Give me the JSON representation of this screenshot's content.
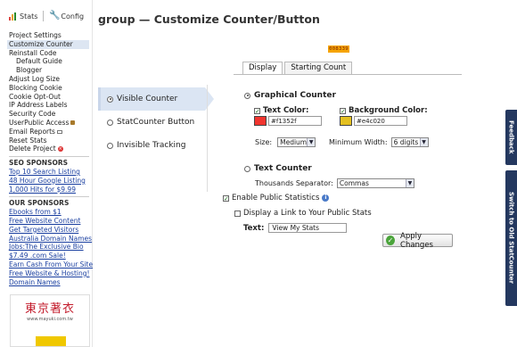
{
  "topnav": {
    "stats_label": "Stats",
    "config_label": "Config"
  },
  "sidebar": {
    "items": [
      {
        "label": "Project Settings",
        "sub": false,
        "active": false
      },
      {
        "label": "Customize Counter",
        "sub": false,
        "active": true
      },
      {
        "label": "Reinstall Code",
        "sub": false,
        "active": false
      },
      {
        "label": "Default Guide",
        "sub": true,
        "active": false
      },
      {
        "label": "Blogger",
        "sub": true,
        "active": false
      },
      {
        "label": "Adjust Log Size",
        "sub": false,
        "active": false
      },
      {
        "label": "Blocking Cookie",
        "sub": false,
        "active": false
      },
      {
        "label": "Cookie Opt-Out",
        "sub": false,
        "active": false
      },
      {
        "label": "IP Address Labels",
        "sub": false,
        "active": false
      },
      {
        "label": "Security Code",
        "sub": false,
        "active": false
      },
      {
        "label": "UserPublic Access",
        "sub": false,
        "active": false,
        "icon": "lock-icon"
      },
      {
        "label": "Email Reports",
        "sub": false,
        "active": false,
        "icon": "mail-icon"
      },
      {
        "label": "Reset Stats",
        "sub": false,
        "active": false
      },
      {
        "label": "Delete Project",
        "sub": false,
        "active": false,
        "icon": "delete-icon"
      }
    ],
    "seo_sponsors_title": "SEO SPONSORS",
    "seo_sponsors": [
      "Top 10 Search Listing",
      "48 Hour Google Listing",
      "1,000 Hits for $9.99"
    ],
    "our_sponsors_title": "OUR SPONSORS",
    "our_sponsors": [
      "Ebooks from $1",
      "Free Website Content",
      "Get Targeted Visitors",
      "Australia Domain Names",
      "Jobs:The Exclusive Bio",
      "$7.49 .com Sale!",
      "Earn Cash From Your Site",
      "Free Website & Hosting!",
      "Domain Names"
    ],
    "ad": {
      "title": "東京著衣",
      "url": "www.mayuki.com.tw"
    }
  },
  "page_title": "group — Customize Counter/Button",
  "counter_badge": "008339",
  "tabs": [
    {
      "label": "Display",
      "active": true
    },
    {
      "label": "Starting Count",
      "active": false
    }
  ],
  "counter_types": [
    {
      "label": "Visible Counter",
      "selected": true
    },
    {
      "label": "StatCounter Button",
      "selected": false
    },
    {
      "label": "Invisible Tracking",
      "selected": false
    }
  ],
  "options": {
    "graphical_label": "Graphical Counter",
    "text_color_label": "Text Color:",
    "text_color_value": "#f1352f",
    "bg_color_label": "Background Color:",
    "bg_color_value": "#e4c020",
    "size_label": "Size:",
    "size_value": "Medium",
    "min_width_label": "Minimum Width:",
    "min_width_value": "6 digits",
    "text_counter_label": "Text Counter",
    "thousands_label": "Thousands Separator:",
    "thousands_value": "Commas",
    "enable_public_label": "Enable Public Statistics",
    "display_link_label": "Display a Link to Your Public Stats",
    "text_label": "Text:",
    "text_value": "View My Stats",
    "apply_label": "Apply Changes"
  },
  "side_tabs": {
    "feedback": "Feedback",
    "switch": "Switch to Old StatCounter"
  },
  "colors": {
    "text_color": "#f1352f",
    "bg_color": "#e4c020",
    "side_tab": "#24385f"
  }
}
